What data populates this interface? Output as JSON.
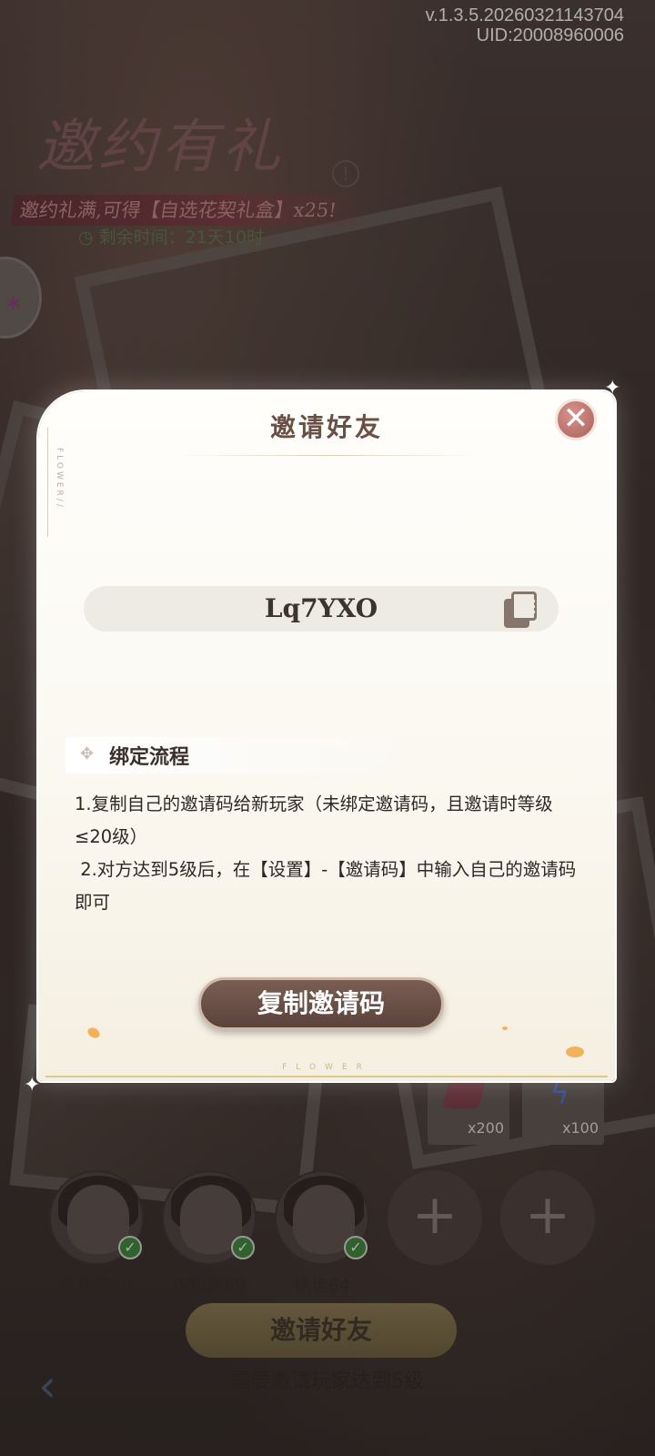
{
  "version": "v.1.3.5.20260321143704",
  "uid": "UID:20008960006",
  "banner": {
    "title": "邀约有礼",
    "subtitle": "邀约礼满,可得【自选花契礼盒】x25!",
    "timer": "剩余时间：21天10时",
    "info_mark": "!"
  },
  "rewards": [
    {
      "count": "x200",
      "icon": "gem-icon"
    },
    {
      "count": "x100",
      "icon": "lightning-icon"
    }
  ],
  "friends": [
    {
      "name": "黄栩瑜58",
      "status": "bound"
    },
    {
      "name": "古栖迟69",
      "status": "bound"
    },
    {
      "name": "徐谙64",
      "status": "bound"
    }
  ],
  "empty_slot_glyph": "+",
  "invite_button_label": "邀请好友",
  "invite_requirement": "需要邀请玩家达到5级",
  "modal": {
    "title": "邀请好友",
    "close_glyph": "✕",
    "side_label": "FLOWER//",
    "invite_code": "Lq7YXO",
    "section_title": "绑定流程",
    "steps": [
      "1.复制自己的邀请码给新玩家（未绑定邀请码，且邀请时等级≤20级）",
      " 2.对方达到5级后，在【设置】-【邀请码】中输入自己的邀请码即可"
    ],
    "copy_button_label": "复制邀请码",
    "bottom_label": "FLOWER"
  },
  "colors": {
    "modal_bg": "#fbf8f1",
    "button_brown": "#6a4f47",
    "close_red": "#b7706a",
    "check_green": "#3b8a3b"
  }
}
